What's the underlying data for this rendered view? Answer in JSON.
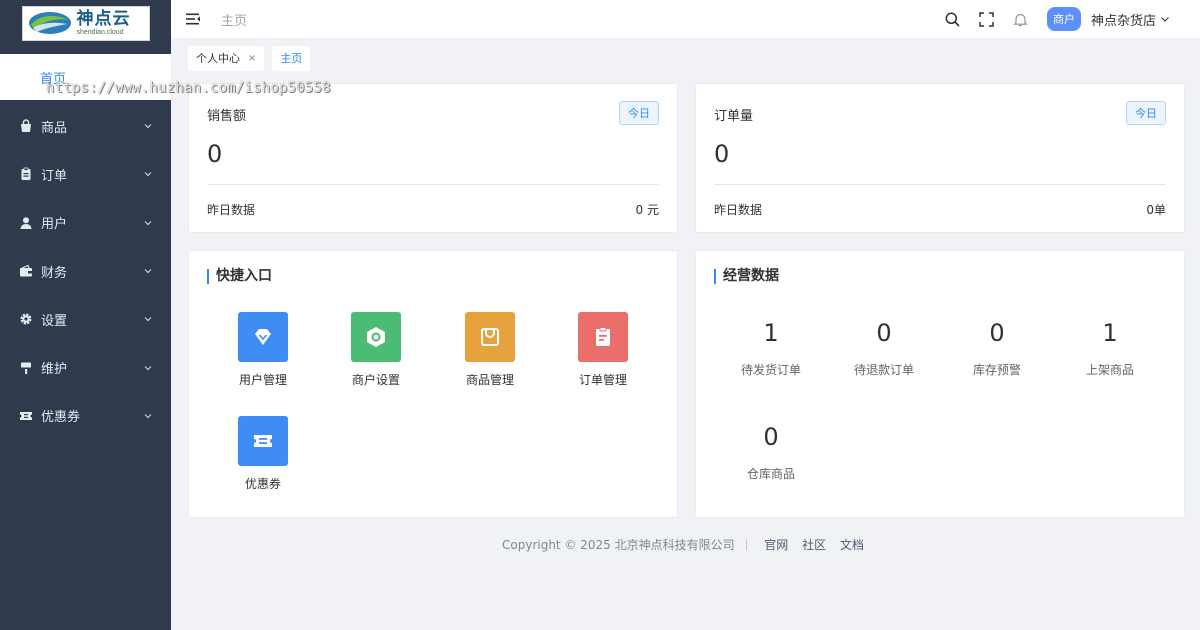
{
  "brand": {
    "logo_text_cn": "神点云",
    "logo_text_en": "shendian.cloud"
  },
  "watermark": "https://www.huzhan.com/ishop50558",
  "sidebar": {
    "home": "首页",
    "items": [
      {
        "label": "商品",
        "icon": "shopping-bag-icon"
      },
      {
        "label": "订单",
        "icon": "clipboard-icon"
      },
      {
        "label": "用户",
        "icon": "user-icon"
      },
      {
        "label": "财务",
        "icon": "wallet-icon"
      },
      {
        "label": "设置",
        "icon": "gear-icon"
      },
      {
        "label": "维护",
        "icon": "brush-icon"
      },
      {
        "label": "优惠券",
        "icon": "coupon-icon"
      }
    ]
  },
  "topbar": {
    "breadcrumb": "主页",
    "role_badge": "商户",
    "store_name": "神点杂货店"
  },
  "tabs": [
    {
      "label": "个人中心",
      "close": "×"
    },
    {
      "label": "主页"
    }
  ],
  "stats": [
    {
      "title": "销售额",
      "badge": "今日",
      "value": "0",
      "foot_label": "昨日数据",
      "foot_value": "0 元"
    },
    {
      "title": "订单量",
      "badge": "今日",
      "value": "0",
      "foot_label": "昨日数据",
      "foot_value": "0单"
    }
  ],
  "quick": {
    "title": "快捷入口",
    "items": [
      {
        "label": "用户管理",
        "color": "#3d8df5",
        "icon": "diamond-icon"
      },
      {
        "label": "商户设置",
        "color": "#4cbb74",
        "icon": "hexagon-icon"
      },
      {
        "label": "商品管理",
        "color": "#e6a23c",
        "icon": "bag-icon"
      },
      {
        "label": "订单管理",
        "color": "#ea6f6a",
        "icon": "clipboard-icon"
      },
      {
        "label": "优惠券",
        "color": "#3d8df5",
        "icon": "ticket-icon"
      }
    ]
  },
  "business": {
    "title": "经营数据",
    "items": [
      {
        "value": "1",
        "label": "待发货订单"
      },
      {
        "value": "0",
        "label": "待退款订单"
      },
      {
        "value": "0",
        "label": "库存预警"
      },
      {
        "value": "1",
        "label": "上架商品"
      },
      {
        "value": "0",
        "label": "仓库商品"
      }
    ]
  },
  "footer": {
    "copyright": "Copyright © 2025 北京神点科技有限公司",
    "links": [
      "官网",
      "社区",
      "文档"
    ]
  }
}
